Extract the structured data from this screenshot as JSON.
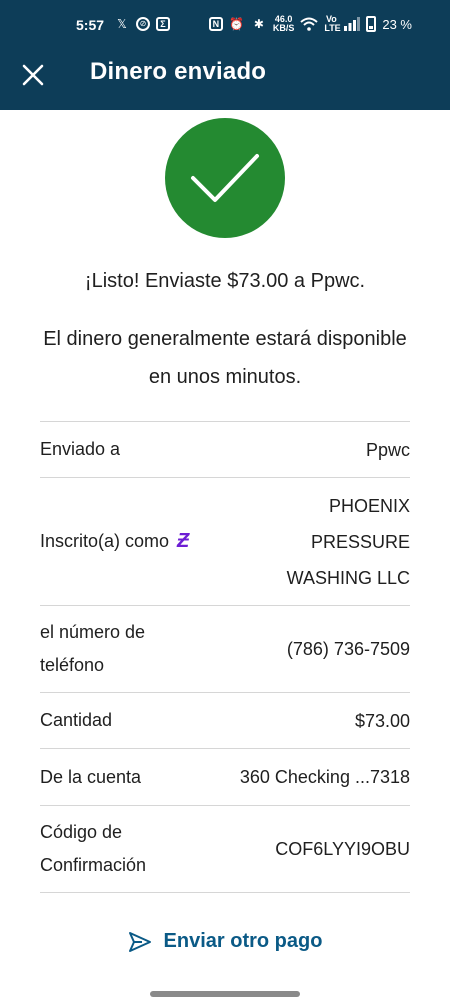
{
  "status_bar": {
    "time": "5:57",
    "speed_top": "46.0",
    "speed_bottom": "KB/S",
    "network": "Vo LTE",
    "battery": "23 %"
  },
  "header": {
    "title": "Dinero enviado"
  },
  "colors": {
    "header_bg": "#0d3d58",
    "success_green": "#248a31",
    "link_blue": "#0b5a86",
    "zelle_purple": "#6d1ed4"
  },
  "message": {
    "confirmation": "¡Listo! Enviaste $73.00 a Ppwc.",
    "availability": "El dinero generalmente estará disponible en unos minutos."
  },
  "details": {
    "sent_to": {
      "label": "Enviado a",
      "value": "Ppwc"
    },
    "enrolled_as": {
      "label": "Inscrito(a) como",
      "icon": "zelle-icon",
      "value": "PHOENIX PRESSURE WASHING LLC"
    },
    "phone": {
      "label": "el número de teléfono",
      "value": "(786) 736-7509"
    },
    "amount": {
      "label": "Cantidad",
      "value": "$73.00"
    },
    "from_account": {
      "label": "De la cuenta",
      "value": "360 Checking ...7318"
    },
    "confirmation_code": {
      "label": "Código de Confirmación",
      "value": "COF6LYYI9OBU"
    }
  },
  "actions": {
    "send_another": "Enviar otro pago"
  }
}
